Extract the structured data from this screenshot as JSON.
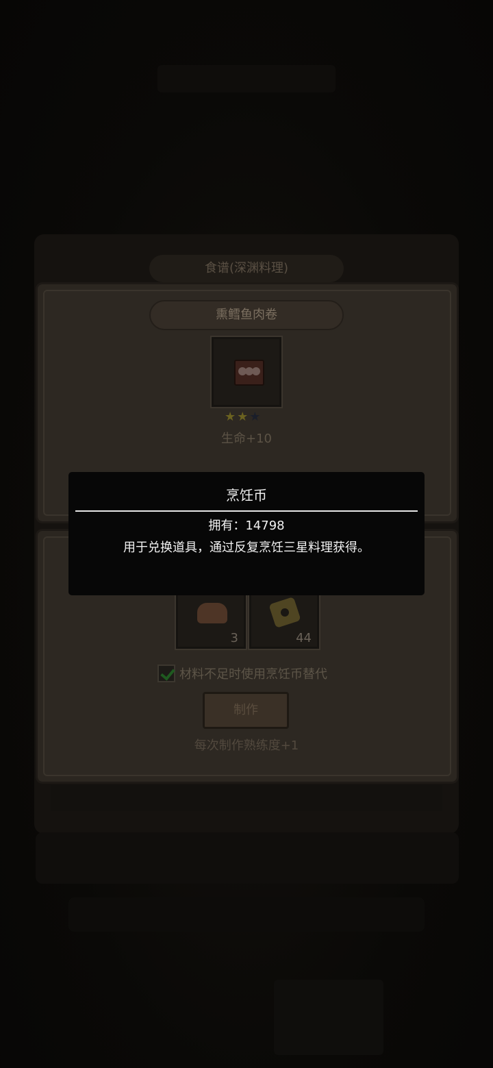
{
  "dialog": {
    "title": "食谱(深渊料理)"
  },
  "recipe": {
    "name": "熏鳕鱼肉卷",
    "stars_filled": 2,
    "stars_total": 3,
    "effect": "生命+10"
  },
  "materials": [
    {
      "icon": "meat-icon",
      "count": "3"
    },
    {
      "icon": "bread-icon",
      "count": "44"
    }
  ],
  "substitute_option": {
    "label": "材料不足时使用烹饪币替代",
    "checked": true
  },
  "make_button": {
    "label": "制作"
  },
  "proficiency_note": "每次制作熟练度+1",
  "tooltip": {
    "title": "烹饪币",
    "owned": "拥有：14798",
    "description": "用于兑换道具，通过反复烹饪三星料理获得。"
  }
}
